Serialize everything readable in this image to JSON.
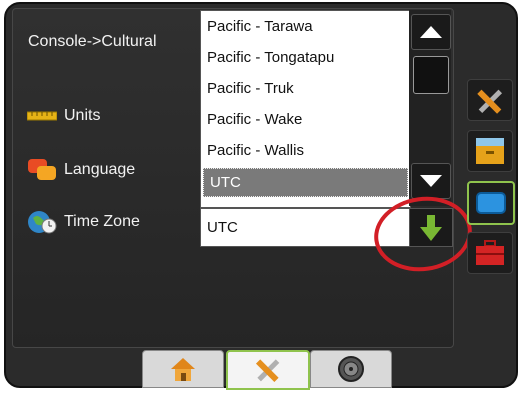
{
  "breadcrumb": "Console->Cultural",
  "menu": [
    {
      "label": "Units",
      "icon": "ruler-icon"
    },
    {
      "label": "Language",
      "icon": "speech-bubbles-icon"
    },
    {
      "label": "Time Zone",
      "icon": "globe-clock-icon"
    }
  ],
  "timezone_dropdown": {
    "options": [
      "Pacific - Tarawa",
      "Pacific - Tongatapu",
      "Pacific - Truk",
      "Pacific - Wake",
      "Pacific - Wallis",
      "UTC"
    ],
    "highlighted": "UTC"
  },
  "timezone_select": {
    "value": "UTC"
  },
  "right_toolbar": [
    "tools-icon",
    "storage-drawer-icon",
    "screen-icon",
    "toolbox-icon"
  ],
  "bottom_tabs": [
    "home-icon",
    "tools-icon",
    "gauge-icon"
  ],
  "colors": {
    "accent_green": "#8fc34d",
    "callout_red": "#d21f26"
  }
}
